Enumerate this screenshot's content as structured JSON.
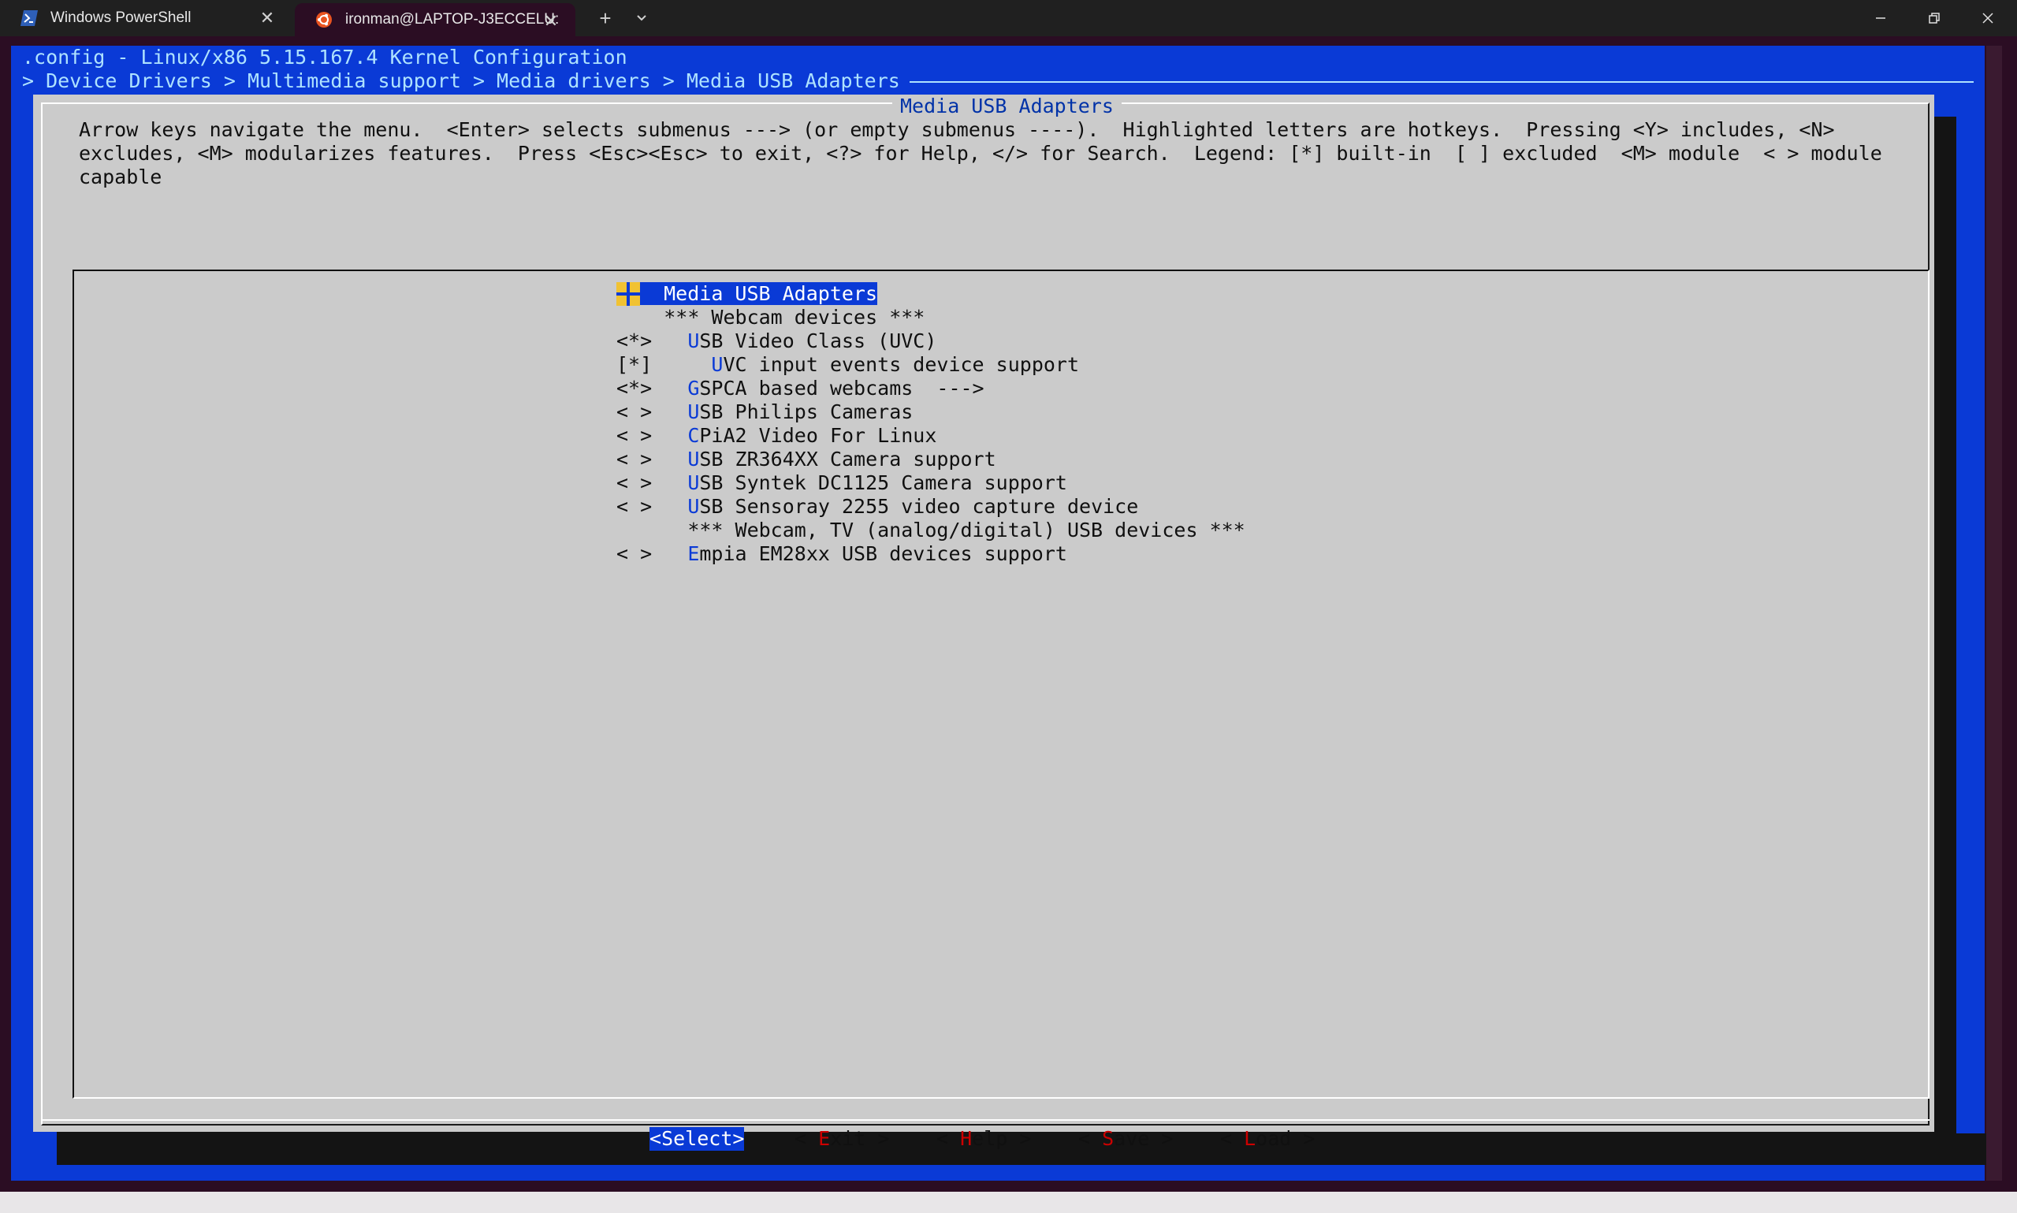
{
  "tabs": [
    {
      "label": "Windows PowerShell",
      "icon": "powershell-icon"
    },
    {
      "label": "ironman@LAPTOP-J3ECCELU:",
      "icon": "ubuntu-icon"
    }
  ],
  "menuconfig": {
    "title_line": ".config - Linux/x86 5.15.167.4 Kernel Configuration",
    "breadcrumb": "> Device Drivers > Multimedia support > Media drivers > Media USB Adapters",
    "dialog_title": "Media USB Adapters",
    "instructions": [
      "Arrow keys navigate the menu.  <Enter> selects submenus ---> (or empty submenus ----).  Highlighted letters are hotkeys.  Pressing <Y> includes, <N>",
      "excludes, <M> modularizes features.  Press <Esc><Esc> to exit, <?> for Help, </> for Search.  Legend: [*] built-in  [ ] excluded  <M> module  < > module",
      "capable"
    ],
    "items": [
      {
        "prefix": "",
        "hotkey": "",
        "text": "Media USB Adapters",
        "selected": true
      },
      {
        "prefix": "    ",
        "hotkey": "",
        "text": "*** Webcam devices ***"
      },
      {
        "prefix": "<*>   ",
        "hotkey": "U",
        "text": "SB Video Class (UVC)"
      },
      {
        "prefix": "[*]     ",
        "hotkey": "U",
        "text": "VC input events device support"
      },
      {
        "prefix": "<*>   ",
        "hotkey": "G",
        "text": "SPCA based webcams  --->"
      },
      {
        "prefix": "< >   ",
        "hotkey": "U",
        "text": "SB Philips Cameras"
      },
      {
        "prefix": "< >   ",
        "hotkey": "C",
        "text": "PiA2 Video For Linux"
      },
      {
        "prefix": "< >   ",
        "hotkey": "U",
        "text": "SB ZR364XX Camera support"
      },
      {
        "prefix": "< >   ",
        "hotkey": "U",
        "text": "SB Syntek DC1125 Camera support"
      },
      {
        "prefix": "< >   ",
        "hotkey": "U",
        "text": "SB Sensoray 2255 video capture device"
      },
      {
        "prefix": "      ",
        "hotkey": "",
        "text": "*** Webcam, TV (analog/digital) USB devices ***"
      },
      {
        "prefix": "< >   ",
        "hotkey": "E",
        "text": "mpia EM28xx USB devices support"
      }
    ],
    "buttons": [
      {
        "open": "<",
        "hotkey": "S",
        "rest": "elect",
        "close": ">",
        "active": true
      },
      {
        "open": "< ",
        "hotkey": "E",
        "rest": "xit",
        "close": " >"
      },
      {
        "open": "< ",
        "hotkey": "H",
        "rest": "elp",
        "close": " >"
      },
      {
        "open": "< ",
        "hotkey": "S",
        "rest": "ave",
        "close": " >"
      },
      {
        "open": "< ",
        "hotkey": "L",
        "rest": "oad",
        "close": " >"
      }
    ]
  },
  "colors": {
    "terminal_bg": "#2b0d23",
    "screen_blue": "#0a3ad6",
    "dialog_gray": "#cbcbcb",
    "hotkey_red": "#cc0000",
    "title_blue": "#0032a8"
  }
}
